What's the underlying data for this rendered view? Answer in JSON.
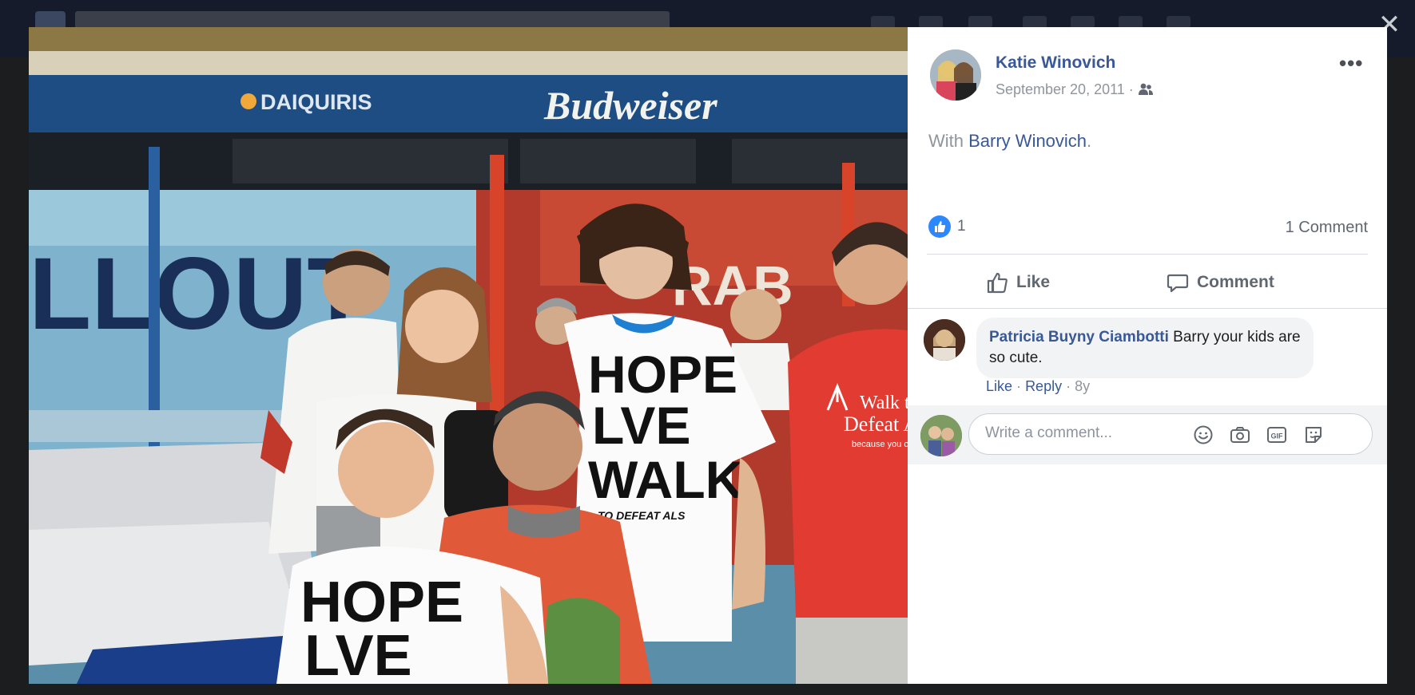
{
  "viewer": {
    "close_icon": "close-icon",
    "close_label": "✕"
  },
  "post": {
    "author": "Katie Winovich",
    "date": "September 20, 2011",
    "date_separator": "·",
    "audience_icon": "friends-icon",
    "more_label": "•••",
    "with_prefix": "With",
    "tagged_person": "Barry Winovich",
    "with_suffix": ".",
    "like_count": "1",
    "comment_count": "1 Comment",
    "actions": {
      "like_label": "Like",
      "comment_label": "Comment"
    }
  },
  "comments": [
    {
      "author": "Patricia Buyny Ciambotti",
      "text": "Barry your kids are so cute.",
      "like_label": "Like",
      "reply_label": "Reply",
      "age": "8y",
      "separator": "·"
    }
  ],
  "composer": {
    "placeholder": "Write a comment...",
    "icons": [
      "emoji-icon",
      "camera-icon",
      "gif-icon",
      "sticker-icon"
    ],
    "gif_label": "GIF"
  },
  "photo": {
    "signs": {
      "daiquiris": "DAIQUIRIS",
      "budweiser": "Budweiser",
      "wall_letters": "LLOUT",
      "crab": "RAB"
    },
    "shirts": {
      "line1": "HOPE",
      "line2": "LVE",
      "line3": "WALK",
      "line4": "TO DEFEAT ALS",
      "red_shirt_line1": "Walk to",
      "red_shirt_line2": "Defeat A",
      "red_shirt_line3": "because you can"
    }
  },
  "colors": {
    "link_blue": "#385898",
    "like_blue": "#2d88ff",
    "meta_gray": "#90949c"
  }
}
